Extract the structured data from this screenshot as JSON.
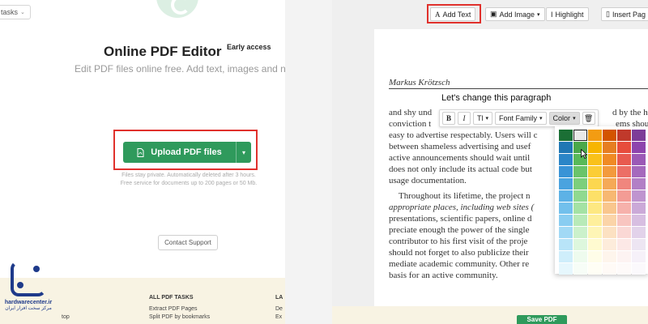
{
  "left": {
    "tasks_label": "tasks",
    "title": "Online PDF Editor",
    "title_badge": "Early access",
    "subtitle": "Edit PDF files online free. Add text, images and n",
    "upload_label": "Upload PDF files",
    "privacy_line1": "Files stay private. Automatically deleted after 3 hours.",
    "privacy_line2": "Free service for documents up to 200 pages or 50 Mb.",
    "support_label": "Contact Support",
    "footer": {
      "heading": "ALL PDF TASKS",
      "heading2": "LA",
      "link1": "Extract PDF Pages",
      "link2": "Split PDF by bookmarks",
      "left_fragment": "top",
      "right_fragment1": "De",
      "right_fragment2": "Ex"
    },
    "watermark": {
      "name": "hardwarecenter.ir",
      "subtitle": "مرکز سخت افزار ایران"
    }
  },
  "right": {
    "toolbar": {
      "add_text": "Add Text",
      "add_image": "Add Image",
      "highlight": "Highlight",
      "insert_page": "Insert Pag"
    },
    "doc": {
      "author": "Markus Krötzsch",
      "editing_line": "Let's change this paragraph",
      "lines": [
        "and shy und",
        "conviction t",
        "easy to advertise respectably. Users will c",
        "between shameless advertising and usef",
        "active announcements should wait until",
        "does not only include its actual code but",
        "usage documentation."
      ],
      "line1_tail": "d by the h",
      "line2_tail": "ems shou",
      "para2": [
        "Throughout its lifetime, the project n",
        "appropriate places, including web sites (",
        "presentations, scientific papers, online d",
        "preciate enough the power of the single",
        "contributor to his first visit of the proje",
        "should not forget to also publicize their",
        "mediate academic community. Other re",
        "basis for an active community."
      ]
    },
    "format_bar": {
      "bold": "B",
      "italic": "I",
      "size": "Tl",
      "font_family": "Font Family",
      "color": "Color"
    },
    "save_label": "Save PDF",
    "palette_colors": [
      [
        "#1b6f35",
        "#e9e9e9",
        "#f39c12",
        "#d35400",
        "#c0392b",
        "#7d3c98"
      ],
      [
        "#1f77b4",
        "#4aa84a",
        "#f7b500",
        "#e67e22",
        "#e74c3c",
        "#8e44ad"
      ],
      [
        "#2a85c7",
        "#58b958",
        "#f9c11a",
        "#f08a24",
        "#e85a4f",
        "#9b59b6"
      ],
      [
        "#3993d6",
        "#6ac46a",
        "#fbcd36",
        "#f39a3d",
        "#ec6f66",
        "#a569bd"
      ],
      [
        "#4aa3df",
        "#7ccf7c",
        "#fcd74f",
        "#f5a957",
        "#f0867e",
        "#b27fc6"
      ],
      [
        "#5db2e6",
        "#90d990",
        "#fde068",
        "#f7b872",
        "#f39c95",
        "#bf94cf"
      ],
      [
        "#72c0ec",
        "#a4e2a4",
        "#fde882",
        "#f9c68d",
        "#f6b1ab",
        "#cba9d8"
      ],
      [
        "#89cdf1",
        "#b8eab8",
        "#feef9c",
        "#fbd4a8",
        "#f8c5c0",
        "#d7bee1"
      ],
      [
        "#a1d9f5",
        "#cbf1cb",
        "#fef5b6",
        "#fce1c2",
        "#fad8d5",
        "#e2d2ea"
      ],
      [
        "#b8e4f8",
        "#ddf7dd",
        "#fffad0",
        "#fdecdb",
        "#fce8e6",
        "#ede5f2"
      ],
      [
        "#cfeefb",
        "#eefbee",
        "#fffde8",
        "#fef5ec",
        "#fdf3f2",
        "#f6f1f9"
      ],
      [
        "#e6f7fd",
        "#f7fdf7",
        "#fffef5",
        "#fffaf6",
        "#fefaf9",
        "#fbf9fc"
      ]
    ]
  }
}
